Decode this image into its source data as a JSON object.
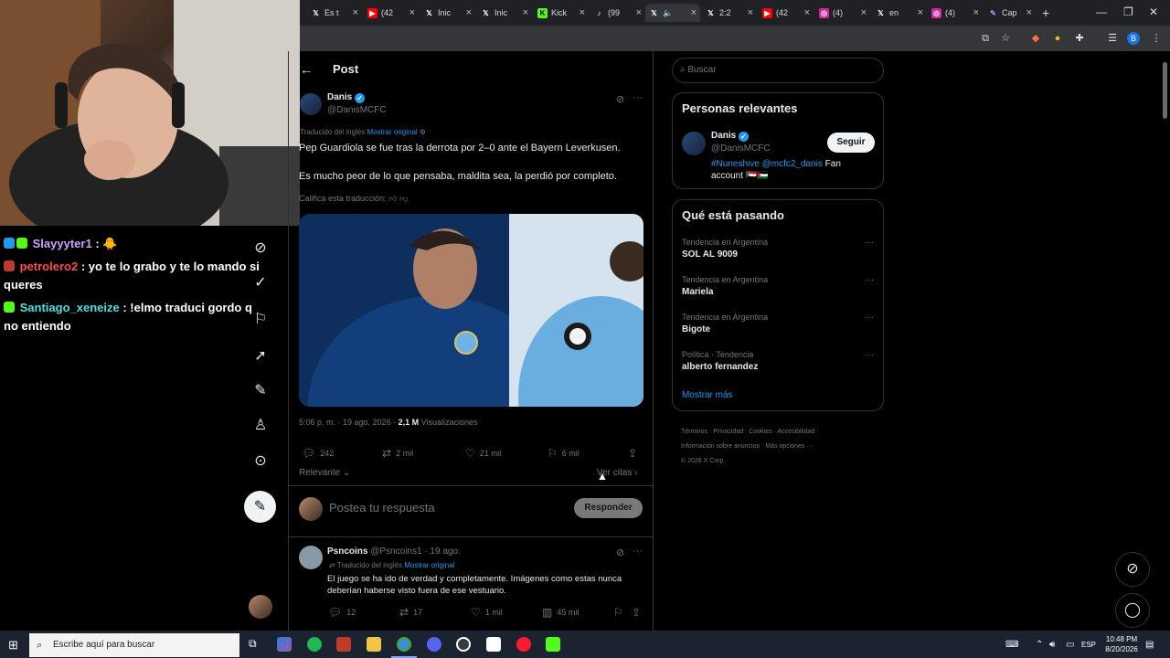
{
  "browser": {
    "tabs": [
      {
        "label": "Es t",
        "icon": "x-icon"
      },
      {
        "label": "(42",
        "icon": "youtube-icon"
      },
      {
        "label": "Inic",
        "icon": "x-icon"
      },
      {
        "label": "Inic",
        "icon": "x-icon"
      },
      {
        "label": "Kick",
        "icon": "kick-icon"
      },
      {
        "label": "(99",
        "icon": "tiktok-icon"
      },
      {
        "label": "",
        "icon": "x-icon",
        "active": true
      },
      {
        "label": "2:2",
        "icon": "x-icon"
      },
      {
        "label": "(42",
        "icon": "youtube-icon"
      },
      {
        "label": "(4)",
        "icon": "instagram-icon"
      },
      {
        "label": "en",
        "icon": "x-icon"
      },
      {
        "label": "(4)",
        "icon": "instagram-icon"
      },
      {
        "label": "Cap",
        "icon": "pen-icon"
      }
    ],
    "new_tab": "+",
    "profile_letter": "B"
  },
  "chat": {
    "messages": [
      {
        "user": "Slayyyter1",
        "user_color": "#c8a2ff",
        "text": ": 🐥"
      },
      {
        "user": "petrolero2",
        "user_color": "#ff4d4d",
        "text": ": yo te lo grabo y te lo mando si queres"
      },
      {
        "user": "Santiago_xeneize",
        "user_color": "#4ee0e0",
        "text": ": !elmo traduci gordo q no entiendo"
      }
    ]
  },
  "post": {
    "header_title": "Post",
    "author_name": "Danis",
    "author_handle": "@DanisMCFC",
    "translated_label": "Traducido del inglés",
    "show_original": "Mostrar original",
    "text_line1": "Pep Guardiola se fue tras la derrota por 2–0 ante el Bayern Leverkusen.",
    "text_line2": "Es mucho peor de lo que pensaba, maldita sea, la perdió por completo.",
    "rate_translation": "Califica esta traducción:",
    "timestamp": "5:06 p. m. · 19 ago. 2026 ·",
    "views_count": "2,1 M",
    "views_label": "Visualizaciones",
    "replies": "242",
    "reposts": "2 mil",
    "likes": "21 mil",
    "bookmarks": "6 mil",
    "sort_label": "Relevante",
    "quotes_label": "Ver citas",
    "reply_placeholder": "Postea tu respuesta",
    "reply_button": "Responder"
  },
  "reply": {
    "author_name": "Psncoins",
    "author_handle": "@Psncoins1",
    "date": "· 19 ago.",
    "translated_label": "Traducido del inglés",
    "show_original": "Mostrar original",
    "text": "El juego se ha ido de verdad y completamente. Imágenes como estas nunca deberían haberse visto fuera de ese vestuario.",
    "replies": "12",
    "reposts": "17",
    "likes": "1 mil",
    "views": "45 mil"
  },
  "sidebar": {
    "search_placeholder": "Buscar",
    "relevant_title": "Personas relevantes",
    "relevant_person": {
      "name": "Danis",
      "handle": "@DanisMCFC",
      "follow_button": "Seguir",
      "bio_hashtag": "#Nuneshive",
      "bio_mention": "@mcfc2_danis",
      "bio_rest": "Fan",
      "bio_line2": "account 🇸🇩🇵🇸"
    },
    "trending_title": "Qué está pasando",
    "trends": [
      {
        "meta": "Tendencia en Argentina",
        "name": "SOL AL 9009"
      },
      {
        "meta": "Tendencia en Argentina",
        "name": "Mariela"
      },
      {
        "meta": "Tendencia en Argentina",
        "name": "Bigote"
      },
      {
        "meta": "Política · Tendencia",
        "name": "alberto fernandez"
      }
    ],
    "show_more": "Mostrar más",
    "footer_line1": [
      "Términos",
      "Privacidad",
      "Cookies",
      "Accesibilidad"
    ],
    "footer_line2": [
      "Información sobre anuncios",
      "Más opciones ···"
    ],
    "footer_line3": "© 2026 X Corp."
  },
  "taskbar": {
    "search_placeholder": "Escribe aquí para buscar",
    "language": "ESP",
    "time": "10:48 PM",
    "date": "8/20/2026"
  },
  "colors": {
    "accent": "#1d9bf0",
    "background": "#000000",
    "border": "#2f3336",
    "muted": "#71767b"
  }
}
